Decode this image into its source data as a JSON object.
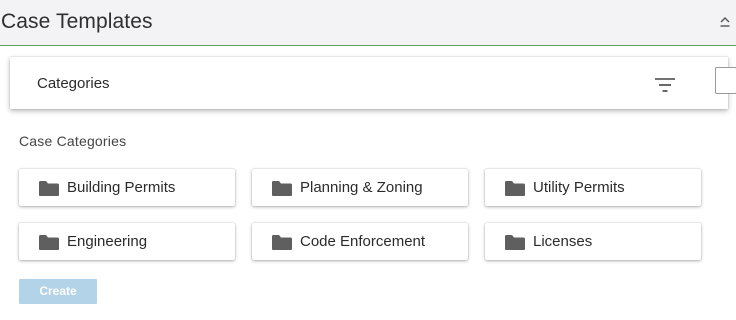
{
  "header": {
    "title": "Case Templates",
    "collapse_icon": "chevron-up-icon"
  },
  "panel": {
    "title": "Categories",
    "filter_icon": "filter-icon"
  },
  "section": {
    "label": "Case Categories"
  },
  "categories": [
    {
      "label": "Building Permits",
      "icon": "folder-icon"
    },
    {
      "label": "Planning & Zoning",
      "icon": "folder-icon"
    },
    {
      "label": "Utility Permits",
      "icon": "folder-icon"
    },
    {
      "label": "Engineering",
      "icon": "folder-icon"
    },
    {
      "label": "Code Enforcement",
      "icon": "folder-icon"
    },
    {
      "label": "Licenses",
      "icon": "folder-icon"
    }
  ],
  "actions": {
    "create_label": "Create"
  },
  "colors": {
    "header_bg": "#f3f3f6",
    "header_border": "#5aa55a",
    "folder": "#5f5f5f",
    "create_bg": "#b3d3e8"
  }
}
